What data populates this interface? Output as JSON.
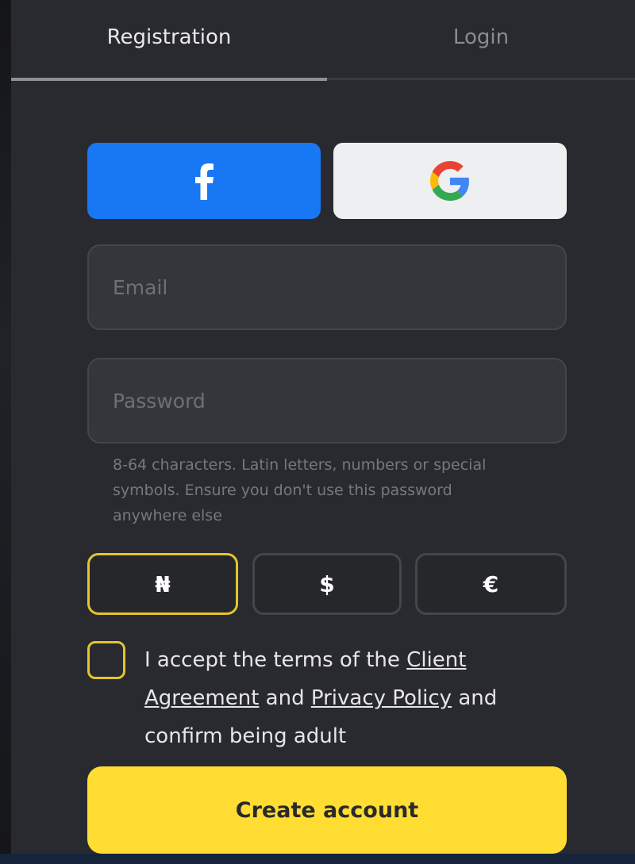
{
  "tabs": {
    "registration": "Registration",
    "login": "Login"
  },
  "social": {
    "facebook_icon": "facebook-f-icon",
    "google_icon": "google-g-icon"
  },
  "form": {
    "email_placeholder": "Email",
    "email_value": "",
    "password_placeholder": "Password",
    "password_value": "",
    "password_hint": "8-64 characters. Latin letters, numbers or special symbols. Ensure you don't use this password anywhere else"
  },
  "currencies": [
    {
      "symbol": "₦",
      "selected": true
    },
    {
      "symbol": "$",
      "selected": false
    },
    {
      "symbol": "€",
      "selected": false
    }
  ],
  "terms": {
    "checked": false,
    "text_1": "I accept the terms of the ",
    "client_agreement": "Client Agreement",
    "text_2": " and ",
    "privacy_policy": "Privacy Policy",
    "text_3": " and confirm being adult"
  },
  "submit": {
    "label": "Create account"
  },
  "colors": {
    "accent": "#ffdd33",
    "selected_border": "#e2c52f",
    "facebook": "#1877f2",
    "panel": "#292a2f"
  }
}
